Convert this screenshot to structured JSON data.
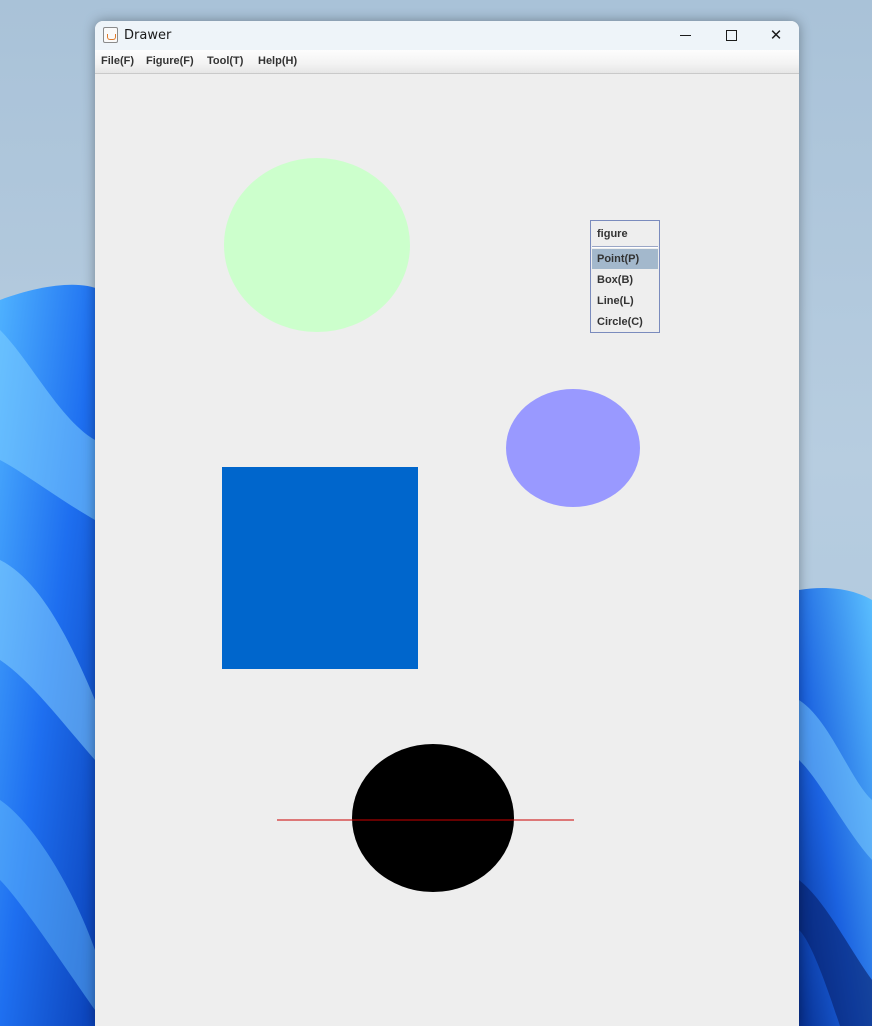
{
  "window": {
    "title": "Drawer"
  },
  "menubar": {
    "items": [
      {
        "label": "File(F)"
      },
      {
        "label": "Figure(F)"
      },
      {
        "label": "Tool(T)"
      },
      {
        "label": "Help(H)"
      }
    ]
  },
  "popup_menu": {
    "title": "figure",
    "items": [
      {
        "label": "Point(P)",
        "highlighted": true
      },
      {
        "label": "Box(B)"
      },
      {
        "label": "Line(L)"
      },
      {
        "label": "Circle(C)"
      }
    ]
  },
  "canvas_figures": [
    {
      "type": "circle",
      "color": "#ccffcc"
    },
    {
      "type": "circle",
      "color": "#9999ff"
    },
    {
      "type": "box",
      "color": "#0066cc"
    },
    {
      "type": "circle",
      "color": "#000000"
    },
    {
      "type": "line",
      "color": "#cc0000"
    }
  ],
  "colors": {
    "desktop_accent": "#1a73e8",
    "canvas_background": "#eeeeee",
    "menu_highlight": "#a3b8cc"
  }
}
